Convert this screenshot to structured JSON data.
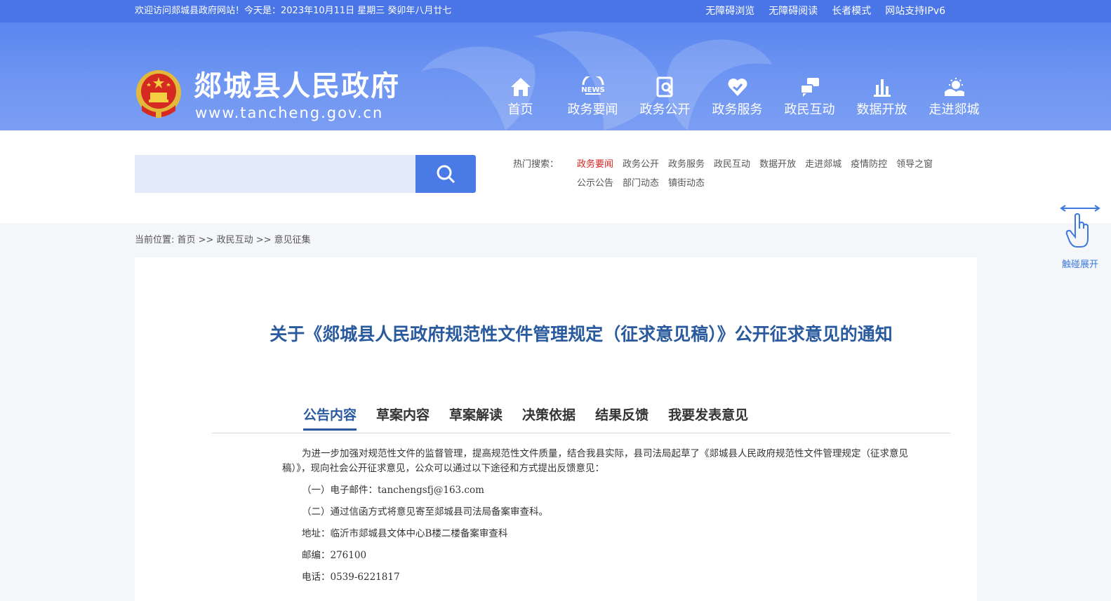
{
  "topbar": {
    "welcome": "欢迎访问郯城县政府网站！今天是：2023年10月11日   星期三   癸卯年八月廿七",
    "links": [
      "无障碍浏览",
      "无障碍阅读",
      "长者模式",
      "网站支持IPv6"
    ]
  },
  "header": {
    "title": "郯城县人民政府",
    "domain": "www.tancheng.gov.cn"
  },
  "nav": {
    "items": [
      {
        "label": "首页",
        "icon": "home-icon"
      },
      {
        "label": "政务要闻",
        "icon": "news-icon",
        "icon_text": "NEWS"
      },
      {
        "label": "政务公开",
        "icon": "document-search-icon"
      },
      {
        "label": "政务服务",
        "icon": "heart-service-icon"
      },
      {
        "label": "政民互动",
        "icon": "chat-icon"
      },
      {
        "label": "数据开放",
        "icon": "bar-chart-icon"
      },
      {
        "label": "走进郯城",
        "icon": "sun-landscape-icon"
      }
    ]
  },
  "search": {
    "placeholder": "",
    "hot_label": "热门搜索：",
    "hot_items": [
      "政务要闻",
      "政务公开",
      "政务服务",
      "政民互动",
      "数据开放",
      "走进郯城",
      "疫情防控",
      "领导之窗",
      "公示公告",
      "部门动态",
      "镇街动态"
    ],
    "hot_active": "政务要闻"
  },
  "side_widget": {
    "label": "触碰展开"
  },
  "breadcrumb": {
    "prefix": "当前位置: ",
    "home": "首页",
    "sep": " >> ",
    "level1": "政民互动",
    "level2": "意见征集"
  },
  "document": {
    "title": "关于《郯城县人民政府规范性文件管理规定（征求意见稿）》公开征求意见的通知"
  },
  "tabs": {
    "items": [
      "公告内容",
      "草案内容",
      "草案解读",
      "决策依据",
      "结果反馈",
      "我要发表意见"
    ],
    "active": "公告内容"
  },
  "article": {
    "intro": "为进一步加强对规范性文件的监督管理，提高规范性文件质量，结合我县实际，县司法局起草了《郯城县人民政府规范性文件管理规定（征求意见稿）》，现向社会公开征求意见，公众可以通过以下途径和方式提出反馈意见：",
    "email_line": "（一）电子邮件：tanchengsfj@163.com",
    "mail_line": "（二）通过信函方式将意见寄至郯城县司法局备案审查科。",
    "address_line": "地址：临沂市郯城县文体中心B楼二楼备案审查科",
    "postcode_line": "邮编：276100",
    "phone_line": "电话：0539-6221817"
  },
  "colors": {
    "topbar": "#4a75e6",
    "header": "#6f96f2",
    "title_blue": "#2a5a9e",
    "hot_active": "#d6231f",
    "search_button": "#4a7ae6"
  }
}
